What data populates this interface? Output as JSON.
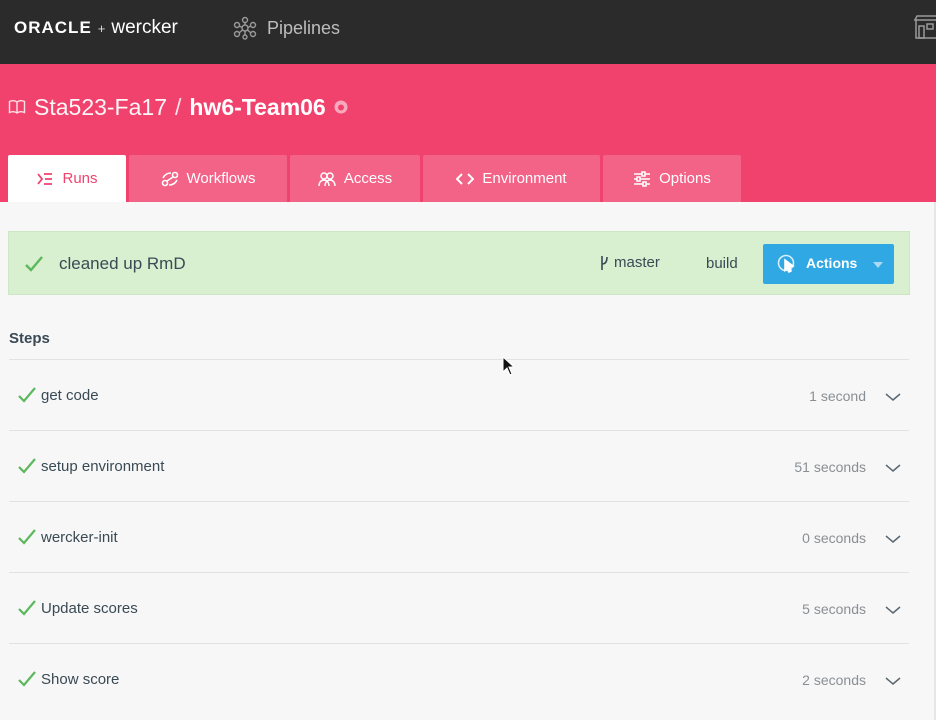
{
  "topbar": {
    "brand_oracle": "ORACLE",
    "brand_plus": "+",
    "brand_wercker": "wercker",
    "pipelines_label": "Pipelines",
    "icons": [
      "pipelines-icon",
      "store-icon"
    ]
  },
  "project": {
    "owner": "Sta523-Fa17",
    "separator": "/",
    "repo": "hw6-Team06",
    "icons": [
      "book-icon",
      "github-icon"
    ]
  },
  "tabs": [
    {
      "label": "Runs",
      "icon": "runs-icon",
      "active": true
    },
    {
      "label": "Workflows",
      "icon": "workflows-icon",
      "active": false
    },
    {
      "label": "Access",
      "icon": "access-icon",
      "active": false
    },
    {
      "label": "Environment",
      "icon": "code-icon",
      "active": false
    },
    {
      "label": "Options",
      "icon": "sliders-icon",
      "active": false
    }
  ],
  "run": {
    "message": "cleaned up RmD",
    "branch": "master",
    "pipeline": "build",
    "actions_label": "Actions",
    "status": "passed"
  },
  "steps": {
    "heading": "Steps",
    "items": [
      {
        "name": "get code",
        "duration": "1 second"
      },
      {
        "name": "setup environment",
        "duration": "51 seconds"
      },
      {
        "name": "wercker-init",
        "duration": "0 seconds"
      },
      {
        "name": "Update scores",
        "duration": "5 seconds"
      },
      {
        "name": "Show score",
        "duration": "2 seconds"
      }
    ]
  },
  "colors": {
    "topbar": "#2b2b2b",
    "brand_pink": "#f1426e",
    "success_green": "#5cb85c",
    "success_bg": "#d8f0cf",
    "actions_blue": "#2fa8e3"
  }
}
